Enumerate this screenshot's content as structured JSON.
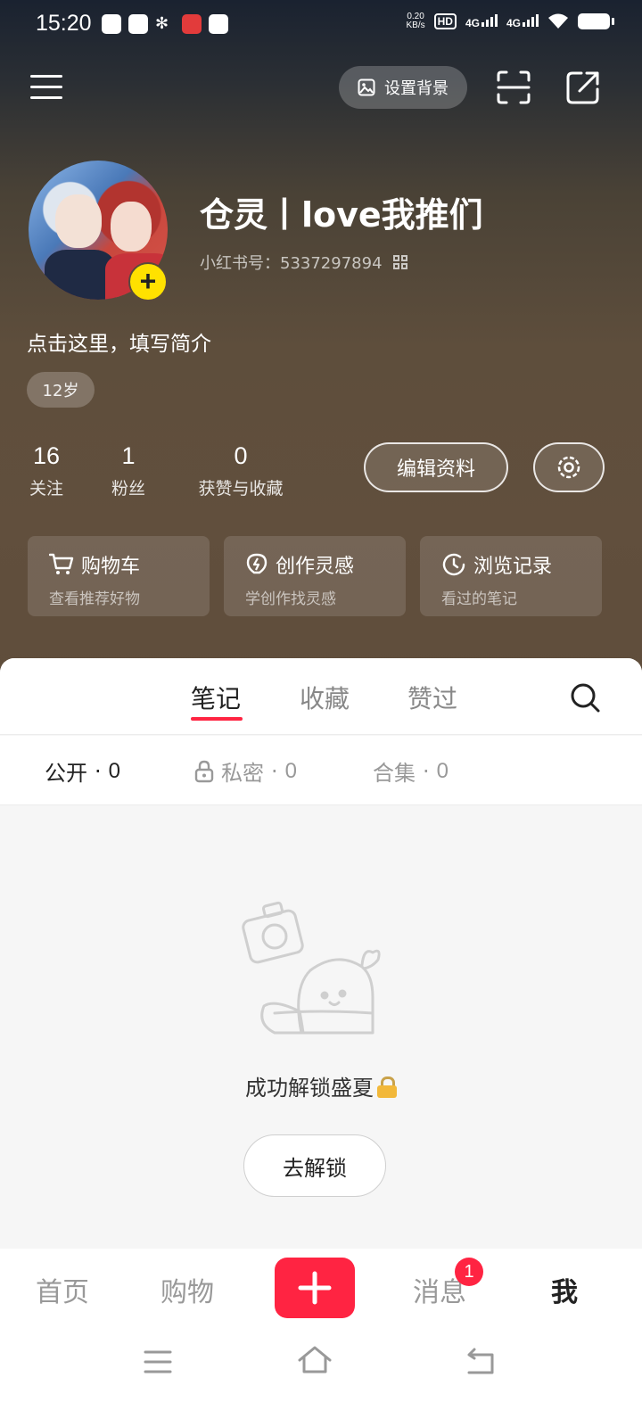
{
  "status_bar": {
    "time": "15:20",
    "net_speed_value": "0.20",
    "net_speed_unit": "KB/s",
    "hd": "HD",
    "sim1": "4G",
    "sim2": "4G"
  },
  "header": {
    "set_background_label": "设置背景"
  },
  "profile": {
    "nickname": "仓灵丨love我推们",
    "red_id": "小红书号：5337297894",
    "bio_placeholder": "点击这里，填写简介",
    "age_tag": "12岁"
  },
  "stats": [
    {
      "value": "16",
      "label": "关注"
    },
    {
      "value": "1",
      "label": "粉丝"
    },
    {
      "value": "0",
      "label": "获赞与收藏"
    }
  ],
  "actions": {
    "edit_profile": "编辑资料"
  },
  "cards": [
    {
      "title": "购物车",
      "subtitle": "查看推荐好物",
      "icon": "cart-icon"
    },
    {
      "title": "创作灵感",
      "subtitle": "学创作找灵感",
      "icon": "lightbulb-icon"
    },
    {
      "title": "浏览记录",
      "subtitle": "看过的笔记",
      "icon": "clock-icon"
    }
  ],
  "tabs": [
    {
      "label": "笔记",
      "active": true
    },
    {
      "label": "收藏",
      "active": false
    },
    {
      "label": "赞过",
      "active": false
    }
  ],
  "subtabs": [
    {
      "label": "公开",
      "count": "0",
      "active": true
    },
    {
      "label": "私密",
      "count": "0",
      "active": false
    },
    {
      "label": "合集",
      "count": "0",
      "active": false
    }
  ],
  "empty_state": {
    "message": "成功解锁盛夏",
    "button": "去解锁"
  },
  "bottom_nav": {
    "home": "首页",
    "shop": "购物",
    "messages": "消息",
    "messages_badge": "1",
    "me": "我"
  },
  "colors": {
    "accent": "#ff2442",
    "avatar_add": "#ffe100"
  }
}
